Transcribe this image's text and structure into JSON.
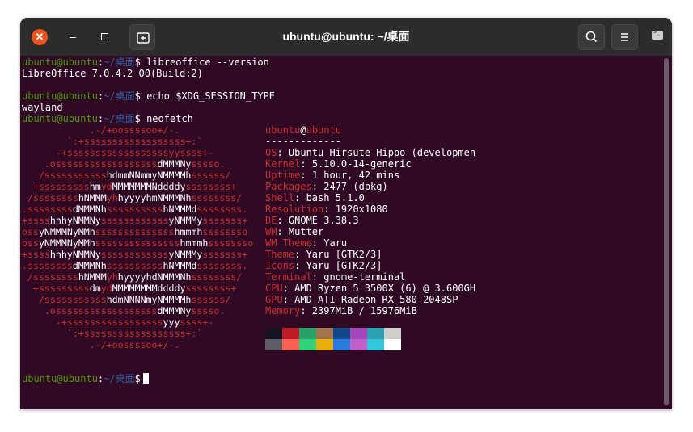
{
  "window": {
    "title": "ubuntu@ubuntu: ~/桌面",
    "close_glyph": "✕",
    "minimize_glyph": "–",
    "buttons": [
      "new-tab-icon",
      "search-icon",
      "menu-icon",
      "terminal-icon"
    ]
  },
  "prompt": {
    "user_host": "ubuntu@ubuntu",
    "sep": ":",
    "path": "~/桌面",
    "symbol": "$"
  },
  "session": [
    {
      "type": "prompt",
      "cmd": " libreoffice --version"
    },
    {
      "type": "output",
      "text": "LibreOffice 7.0.4.2 00(Build:2)"
    },
    {
      "type": "blank"
    },
    {
      "type": "prompt",
      "cmd": " echo $XDG_SESSION_TYPE"
    },
    {
      "type": "output",
      "text": "wayland"
    },
    {
      "type": "prompt",
      "cmd": " neofetch"
    }
  ],
  "neofetch": {
    "logo": [
      [
        [
          "r",
          "            .-/+oossssoo+/-."
        ]
      ],
      [
        [
          "r",
          "        `:+ssssssssssssssssss+:`"
        ]
      ],
      [
        [
          "r",
          "      -+ssssssssssssssssssyyssss+-"
        ]
      ],
      [
        [
          "r",
          "    .ossssssssssssssssss"
        ],
        [
          "w",
          "dMMMNy"
        ],
        [
          "r",
          "sssso."
        ]
      ],
      [
        [
          "r",
          "   /sssssssssss"
        ],
        [
          "w",
          "hdmmNNmmyNMMMMh"
        ],
        [
          "r",
          "ssssss/"
        ]
      ],
      [
        [
          "r",
          "  +sssssssss"
        ],
        [
          "w",
          "hm"
        ],
        [
          "r",
          "yd"
        ],
        [
          "w",
          "MMMMMMMNddddy"
        ],
        [
          "r",
          "ssssssss+"
        ]
      ],
      [
        [
          "r",
          " /ssssssss"
        ],
        [
          "w",
          "hNMMM"
        ],
        [
          "r",
          "yh"
        ],
        [
          "w",
          "hyyyyhmNMMMNh"
        ],
        [
          "r",
          "ssssssss/"
        ]
      ],
      [
        [
          "r",
          ".ssssssss"
        ],
        [
          "w",
          "dMMMNh"
        ],
        [
          "r",
          "ssssssssss"
        ],
        [
          "w",
          "hNMMMd"
        ],
        [
          "r",
          "ssssssss."
        ]
      ],
      [
        [
          "r",
          "+ssss"
        ],
        [
          "w",
          "hhhyNMMNy"
        ],
        [
          "r",
          "ssssssssssss"
        ],
        [
          "w",
          "yNMMMy"
        ],
        [
          "r",
          "sssssss+"
        ]
      ],
      [
        [
          "r",
          "oss"
        ],
        [
          "w",
          "yNMMMNyMMh"
        ],
        [
          "r",
          "ssssssssssssss"
        ],
        [
          "w",
          "hmmmh"
        ],
        [
          "r",
          "ssssssso"
        ]
      ],
      [
        [
          "r",
          "oss"
        ],
        [
          "w",
          "yNMMMNyMMh"
        ],
        [
          "r",
          "sssssssssssssss"
        ],
        [
          "w",
          "hmmmh"
        ],
        [
          "r",
          "ssssssso"
        ]
      ],
      [
        [
          "r",
          "+ssss"
        ],
        [
          "w",
          "hhhyNMMNy"
        ],
        [
          "r",
          "ssssssssssss"
        ],
        [
          "w",
          "yNMMMy"
        ],
        [
          "r",
          "sssssss+"
        ]
      ],
      [
        [
          "r",
          ".ssssssss"
        ],
        [
          "w",
          "dMMMNh"
        ],
        [
          "r",
          "ssssssssss"
        ],
        [
          "w",
          "hNMMMd"
        ],
        [
          "r",
          "ssssssss."
        ]
      ],
      [
        [
          "r",
          " /ssssssss"
        ],
        [
          "w",
          "hNMMM"
        ],
        [
          "r",
          "yh"
        ],
        [
          "w",
          "hyyyyhdNMMMNh"
        ],
        [
          "r",
          "ssssssss/"
        ]
      ],
      [
        [
          "r",
          "  +sssssssss"
        ],
        [
          "w",
          "dm"
        ],
        [
          "r",
          "yd"
        ],
        [
          "w",
          "MMMMMMMMddddy"
        ],
        [
          "r",
          "ssssssss+"
        ]
      ],
      [
        [
          "r",
          "   /sssssssssss"
        ],
        [
          "w",
          "hdmNNNNmyNMMMMh"
        ],
        [
          "r",
          "ssssss/"
        ]
      ],
      [
        [
          "r",
          "    .ossssssssssssssssss"
        ],
        [
          "w",
          "dMMMNy"
        ],
        [
          "r",
          "sssso."
        ]
      ],
      [
        [
          "r",
          "      -+sssssssssssssssss"
        ],
        [
          "w",
          "yyy"
        ],
        [
          "r",
          "ssss+-"
        ]
      ],
      [
        [
          "r",
          "        `:+ssssssssssssssssss+:`"
        ]
      ],
      [
        [
          "r",
          "            .-/+oossssoo+/-."
        ]
      ]
    ],
    "user_host": "ubuntu",
    "at": "@",
    "host": "ubuntu",
    "separator": "-------------",
    "info": [
      {
        "key": "OS",
        "value": "Ubuntu Hirsute Hippo (developmen"
      },
      {
        "key": "Kernel",
        "value": "5.10.0-14-generic"
      },
      {
        "key": "Uptime",
        "value": "1 hour, 42 mins"
      },
      {
        "key": "Packages",
        "value": "2477 (dpkg)"
      },
      {
        "key": "Shell",
        "value": "bash 5.1.0"
      },
      {
        "key": "Resolution",
        "value": "1920x1080"
      },
      {
        "key": "DE",
        "value": "GNOME 3.38.3"
      },
      {
        "key": "WM",
        "value": "Mutter"
      },
      {
        "key": "WM Theme",
        "value": "Yaru"
      },
      {
        "key": "Theme",
        "value": "Yaru [GTK2/3]"
      },
      {
        "key": "Icons",
        "value": "Yaru [GTK2/3]"
      },
      {
        "key": "Terminal",
        "value": "gnome-terminal"
      },
      {
        "key": "CPU",
        "value": "AMD Ryzen 5 3500X (6) @ 3.600GH"
      },
      {
        "key": "GPU",
        "value": "AMD ATI Radeon RX 580 2048SP"
      },
      {
        "key": "Memory",
        "value": "2397MiB / 15976MiB"
      }
    ],
    "colors_row1": [
      "#171421",
      "#c01c28",
      "#26a269",
      "#a2734c",
      "#12488b",
      "#a347ba",
      "#2aa1b3",
      "#d0cfcc"
    ],
    "colors_row2": [
      "#5e5c64",
      "#f66151",
      "#33d17a",
      "#e9ad0c",
      "#2a7bde",
      "#c061cb",
      "#33c7de",
      "#ffffff"
    ]
  },
  "colors": {
    "background": "#300a24",
    "titlebar": "#2c2c2c",
    "prompt_user": "#4e9a06",
    "prompt_path": "#3465a4",
    "logo_red": "#cc2e2e",
    "close_button": "#e95420"
  }
}
